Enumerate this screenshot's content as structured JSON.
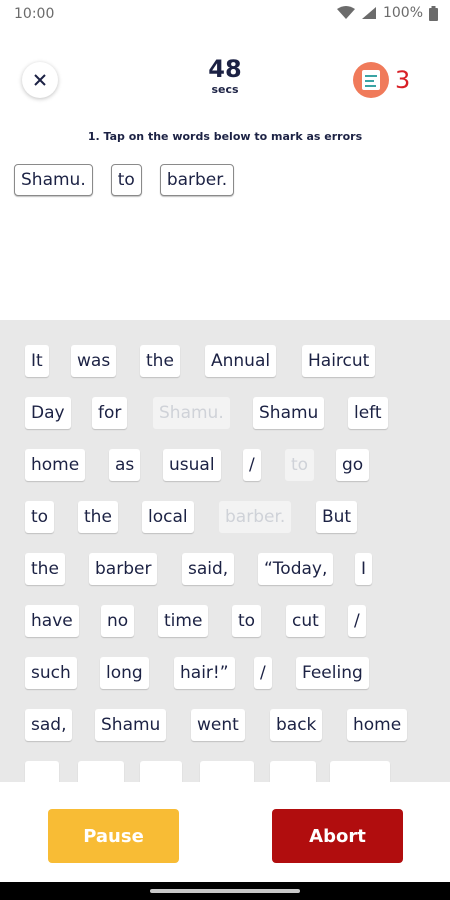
{
  "status": {
    "time": "10:00",
    "battery": "100%"
  },
  "timer": {
    "value": "48",
    "unit": "secs"
  },
  "score": {
    "value": "3"
  },
  "instruction": "1. Tap on the words below to mark as errors",
  "selected_words": [
    "Shamu.",
    "to",
    "barber."
  ],
  "words": [
    {
      "text": "It",
      "faded": false
    },
    {
      "text": "was",
      "faded": false
    },
    {
      "text": "the",
      "faded": false
    },
    {
      "text": "Annual",
      "faded": false
    },
    {
      "text": "Haircut",
      "faded": false
    },
    {
      "text": "Day",
      "faded": false
    },
    {
      "text": "for",
      "faded": false
    },
    {
      "text": "Shamu.",
      "faded": true
    },
    {
      "text": "Shamu",
      "faded": false
    },
    {
      "text": "left",
      "faded": false
    },
    {
      "text": "home",
      "faded": false
    },
    {
      "text": "as",
      "faded": false
    },
    {
      "text": "usual",
      "faded": false
    },
    {
      "text": "/",
      "faded": false
    },
    {
      "text": "to",
      "faded": true
    },
    {
      "text": "go",
      "faded": false
    },
    {
      "text": "to",
      "faded": false
    },
    {
      "text": "the",
      "faded": false
    },
    {
      "text": "local",
      "faded": false
    },
    {
      "text": "barber.",
      "faded": true
    },
    {
      "text": "But",
      "faded": false
    },
    {
      "text": "the",
      "faded": false
    },
    {
      "text": "barber",
      "faded": false
    },
    {
      "text": "said,",
      "faded": false
    },
    {
      "text": "“Today,",
      "faded": false
    },
    {
      "text": "I",
      "faded": false
    },
    {
      "text": "have",
      "faded": false
    },
    {
      "text": "no",
      "faded": false
    },
    {
      "text": "time",
      "faded": false
    },
    {
      "text": "to",
      "faded": false
    },
    {
      "text": "cut",
      "faded": false
    },
    {
      "text": "/",
      "faded": false
    },
    {
      "text": "such",
      "faded": false
    },
    {
      "text": "long",
      "faded": false
    },
    {
      "text": "hair!”",
      "faded": false
    },
    {
      "text": "/",
      "faded": false
    },
    {
      "text": "Feeling",
      "faded": false
    },
    {
      "text": "sad,",
      "faded": false
    },
    {
      "text": "Shamu",
      "faded": false
    },
    {
      "text": "went",
      "faded": false
    },
    {
      "text": "back",
      "faded": false
    },
    {
      "text": "home",
      "faded": false
    }
  ],
  "buttons": {
    "pause": "Pause",
    "abort": "Abort"
  },
  "colors": {
    "pause": "#f8bc35",
    "abort": "#b10d0e",
    "score": "#d81f26",
    "text": "#1c2244"
  }
}
